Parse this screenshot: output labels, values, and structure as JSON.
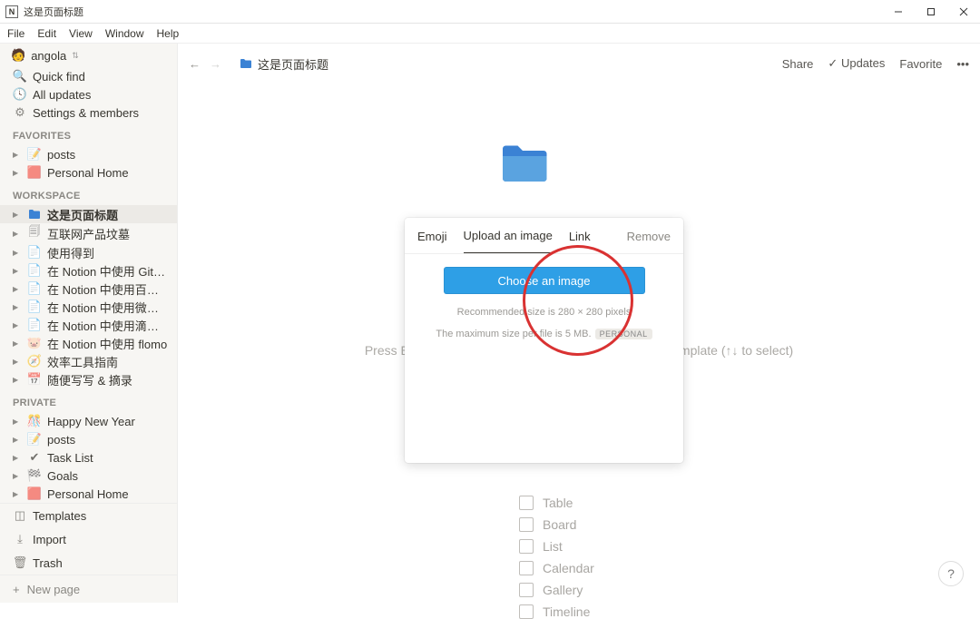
{
  "window": {
    "title": "这是页面标题"
  },
  "menubar": [
    "File",
    "Edit",
    "View",
    "Window",
    "Help"
  ],
  "workspace_name": "angola",
  "sidebar": {
    "quick_find": "Quick find",
    "all_updates": "All updates",
    "settings": "Settings & members",
    "sections": {
      "favorites": "FAVORITES",
      "workspace": "WORKSPACE",
      "private": "PRIVATE"
    },
    "favorites": [
      {
        "icon": "📝",
        "label": "posts"
      },
      {
        "icon": "🟥",
        "label": "Personal Home"
      }
    ],
    "workspace": [
      {
        "icon": "folder",
        "label": "这是页面标题",
        "selected": true
      },
      {
        "icon": "doc",
        "label": "互联网产品坟墓"
      },
      {
        "icon": "doc",
        "label": "使用得到"
      },
      {
        "icon": "doc",
        "label": "在 Notion 中使用 GitMind"
      },
      {
        "icon": "doc",
        "label": "在 Notion 中使用百度脑图"
      },
      {
        "icon": "doc",
        "label": "在 Notion 中使用微信读书"
      },
      {
        "icon": "doc",
        "label": "在 Notion 中使用滴答清单"
      },
      {
        "icon": "🐷",
        "label": "在 Notion 中使用 flomo"
      },
      {
        "icon": "🧭",
        "label": "效率工具指南"
      },
      {
        "icon": "📅",
        "label": "随便写写 & 摘录"
      }
    ],
    "private": [
      {
        "icon": "🎊",
        "label": "Happy New Year"
      },
      {
        "icon": "📝",
        "label": "posts"
      },
      {
        "icon": "✔",
        "label": "Task List"
      },
      {
        "icon": "🏁",
        "label": "Goals"
      },
      {
        "icon": "🟥",
        "label": "Personal Home"
      }
    ],
    "templates": "Templates",
    "import": "Import",
    "trash": "Trash",
    "new_page": "New page"
  },
  "topbar": {
    "crumb": "这是页面标题",
    "share": "Share",
    "updates": "Updates",
    "favorite": "Favorite"
  },
  "page_hint": "Press Enter to continue with an empty page, or pick a template (↑↓ to select)",
  "template_options": [
    "Table",
    "Board",
    "List",
    "Calendar",
    "Gallery",
    "Timeline"
  ],
  "popup": {
    "tabs": {
      "emoji": "Emoji",
      "upload": "Upload an image",
      "link": "Link"
    },
    "remove": "Remove",
    "choose": "Choose an image",
    "recommended": "Recommended size is 280 × 280 pixels",
    "max": "The maximum size per file is 5 MB.",
    "badge": "PERSONAL"
  },
  "help": "?"
}
